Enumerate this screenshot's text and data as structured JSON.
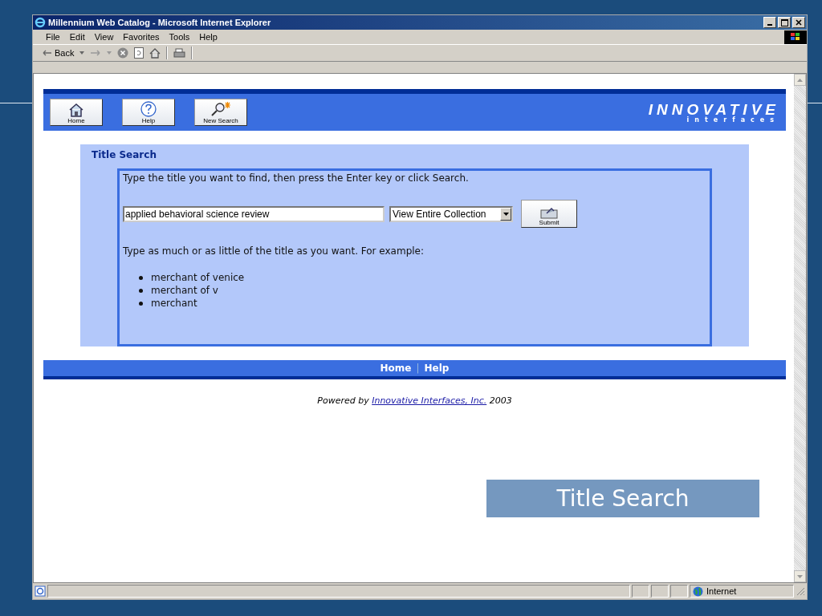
{
  "window": {
    "title": "Millennium Web Catalog - Microsoft Internet Explorer"
  },
  "menu": [
    "File",
    "Edit",
    "View",
    "Favorites",
    "Tools",
    "Help"
  ],
  "toolbar": {
    "back_label": "Back"
  },
  "page": {
    "nav_buttons": [
      {
        "kind": "home",
        "label": "Home"
      },
      {
        "kind": "help",
        "label": "Help"
      },
      {
        "kind": "search",
        "label": "New Search"
      }
    ],
    "logo": {
      "name": "INNOVATIVE",
      "sub": "interfaces"
    },
    "section_title": "Title Search",
    "instruction": "Type the title you want to find, then press the Enter key or click Search.",
    "search_field": {
      "value": "applied behavioral science review"
    },
    "scope_dropdown": {
      "value": "View Entire Collection"
    },
    "submit_button": "Submit",
    "hint": "Type as much or as little of the title as you want. For example:",
    "examples": [
      "merchant of venice",
      "merchant of v",
      "merchant"
    ],
    "footer_links": [
      "Home",
      "Help"
    ],
    "footer_separator": "|",
    "powered_by": {
      "before": "Powered by",
      "link": "Innovative Interfaces, Inc.",
      "after": "2003"
    }
  },
  "status_bar": {
    "zone": "Internet"
  },
  "slide_caption": "Title Search"
}
